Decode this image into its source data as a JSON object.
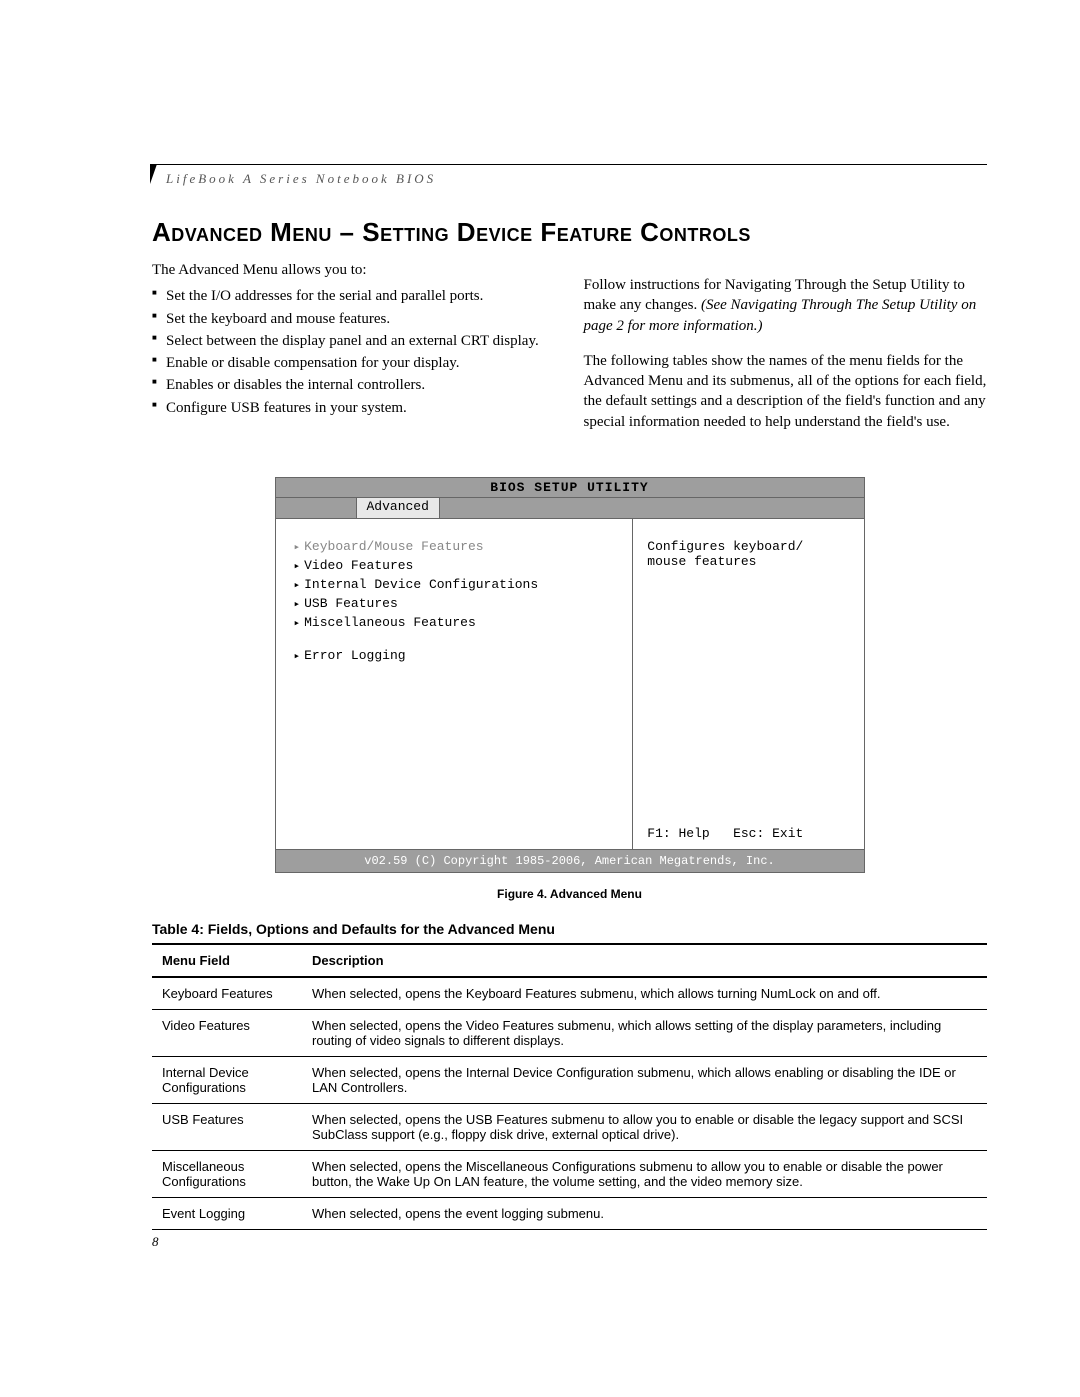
{
  "running_head": "LifeBook A Series Notebook BIOS",
  "title": "Advanced Menu – Setting Device Feature Controls",
  "intro": "The Advanced Menu allows you to:",
  "bullets": [
    "Set the I/O addresses for the serial and parallel ports.",
    "Set the keyboard and mouse features.",
    "Select between the display panel and an external CRT display.",
    "Enable or disable compensation for your display.",
    "Enables or disables the internal controllers.",
    "Configure USB features in your system."
  ],
  "right_p1a": "Follow instructions for Navigating Through the Setup Utility to make any changes. ",
  "right_p1_ital": "(See Navigating Through The Setup Utility on page 2 for more information.)",
  "right_p2": "The following tables show the names of the menu fields for the Advanced Menu and its submenus, all of the options for each field, the default settings and a description of the field's function and any special information needed to help understand the field's use.",
  "bios": {
    "title": "BIOS SETUP UTILITY",
    "tab": "Advanced",
    "items": [
      "Keyboard/Mouse Features",
      "Video Features",
      "Internal Device Configurations",
      "USB Features",
      "Miscellaneous Features",
      "Error Logging"
    ],
    "help_line1": "Configures keyboard/",
    "help_line2": "mouse features",
    "keys": "F1: Help   Esc: Exit",
    "copyright": "v02.59 (C) Copyright 1985-2006, American Megatrends, Inc."
  },
  "figure_caption": "Figure 4.  Advanced Menu",
  "table_caption": "Table 4: Fields, Options and Defaults for the Advanced Menu",
  "th_field": "Menu Field",
  "th_desc": "Description",
  "rows": [
    {
      "f": "Keyboard Features",
      "d": "When selected, opens the Keyboard Features submenu, which allows turning NumLock on and off."
    },
    {
      "f": "Video Features",
      "d": "When selected, opens the Video Features submenu, which allows setting of the display parameters, including routing of video signals to different displays."
    },
    {
      "f": "Internal Device Configurations",
      "d": "When selected, opens the Internal Device Configuration submenu, which allows enabling or disabling the IDE or LAN Controllers."
    },
    {
      "f": "USB Features",
      "d": "When selected, opens the USB Features submenu to allow you to enable or disable the legacy support and SCSI SubClass support (e.g., floppy disk drive, external optical drive)."
    },
    {
      "f": "Miscellaneous Configurations",
      "d": "When selected, opens the Miscellaneous Configurations submenu to allow you to enable or disable the power button, the Wake Up On LAN feature, the volume setting, and the video memory size."
    },
    {
      "f": "Event Logging",
      "d": "When selected, opens the event logging submenu."
    }
  ],
  "page_number": "8"
}
